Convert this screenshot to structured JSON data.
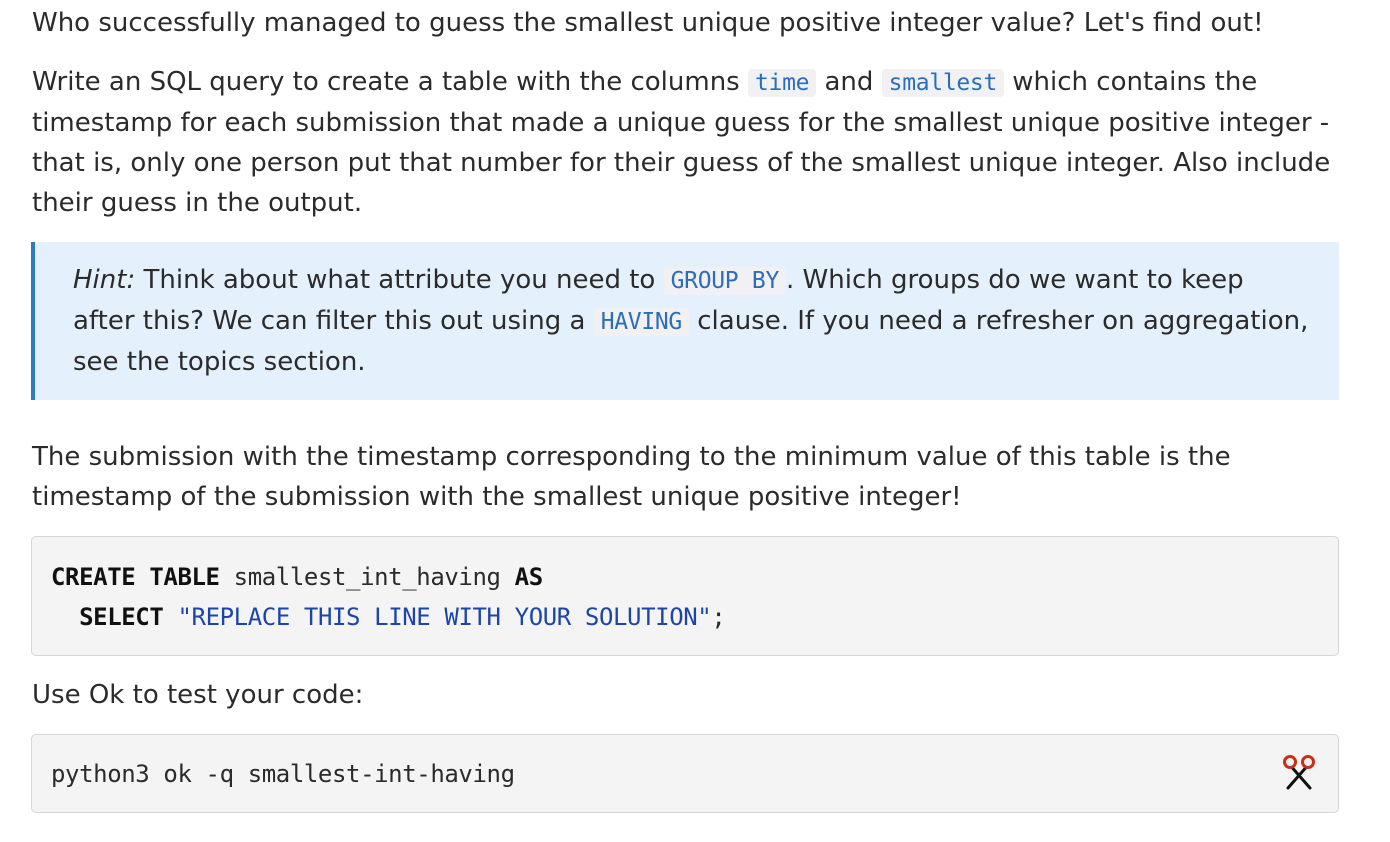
{
  "intro": "Who successfully managed to guess the smallest unique positive integer value? Let's find out!",
  "task": {
    "before": "Write an SQL query to create a table with the columns ",
    "code1": "time",
    "mid": " and ",
    "code2": "smallest",
    "after": " which contains the timestamp for each submission that made a unique guess for the smallest unique positive integer - that is, only one person put that number for their guess of the smallest unique integer. Also include their guess in the output."
  },
  "hint": {
    "label": "Hint:",
    "text1": " Think about what attribute you need to ",
    "code1": "GROUP BY",
    "text2": ". Which groups do we want to keep after this? We can filter this out using a ",
    "code2": "HAVING",
    "text3": " clause. If you need a refresher on aggregation, see the topics section."
  },
  "after": "The submission with the timestamp corresponding to the minimum value of this table is the timestamp of the submission with the smallest unique positive integer!",
  "sql": {
    "l1_kw1": "CREATE TABLE",
    "l1_name": " smallest_int_having ",
    "l1_kw2": "AS",
    "l2_indent": "  ",
    "l2_kw": "SELECT",
    "l2_str": "\"REPLACE THIS LINE WITH YOUR SOLUTION\"",
    "l2_end": ";"
  },
  "ok_text": "Use Ok to test your code:",
  "command": "python3 ok -q smallest-int-having",
  "icons": {
    "copy": "scissors-icon"
  },
  "colors": {
    "hint_bg": "#e4f0fb",
    "hint_border": "#2f7bc1",
    "inline_code": "#2a6ebb",
    "code_bg": "#f4f4f4"
  }
}
